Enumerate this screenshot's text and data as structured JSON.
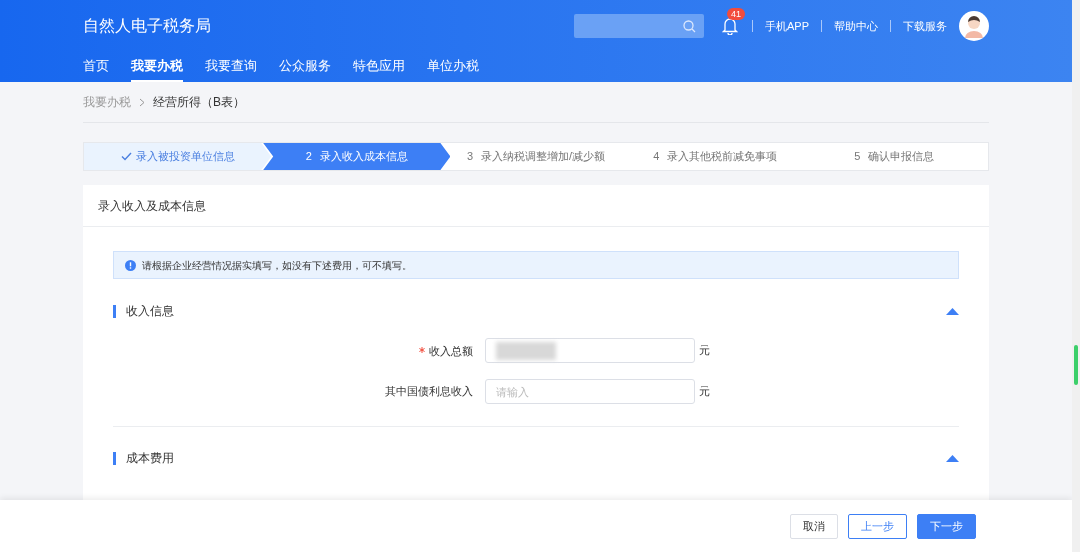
{
  "header": {
    "title": "自然人电子税务局",
    "notification_count": "41",
    "links": [
      "手机APP",
      "帮助中心",
      "下载服务"
    ]
  },
  "nav": [
    {
      "label": "首页",
      "selected": false
    },
    {
      "label": "我要办税",
      "selected": true
    },
    {
      "label": "我要查询",
      "selected": false
    },
    {
      "label": "公众服务",
      "selected": false
    },
    {
      "label": "特色应用",
      "selected": false
    },
    {
      "label": "单位办税",
      "selected": false
    }
  ],
  "breadcrumb": [
    "我要办税",
    "经营所得（B表）"
  ],
  "steps": [
    {
      "label": "录入被投资单位信息",
      "done": true,
      "selected": false
    },
    {
      "number": "2",
      "label": "录入收入成本信息",
      "done": false,
      "selected": true
    },
    {
      "number": "3",
      "label": "录入纳税调整增加/减少额",
      "done": false,
      "selected": false
    },
    {
      "number": "4",
      "label": "录入其他税前减免事项",
      "done": false,
      "selected": false
    },
    {
      "number": "5",
      "label": "确认申报信息",
      "done": false,
      "selected": false
    }
  ],
  "card": {
    "title": "录入收入及成本信息",
    "notice": "请根据企业经营情况据实填写，如没有下述费用，可不填写。",
    "sections": [
      {
        "title": "收入信息",
        "expanded": true,
        "fields": [
          {
            "label": "收入总额",
            "required": true,
            "redacted": true,
            "unit": "元"
          },
          {
            "label": "其中国债利息收入",
            "required": false,
            "redacted": false,
            "placeholder": "请输入",
            "unit": "元"
          }
        ]
      },
      {
        "title": "成本费用",
        "expanded": true
      }
    ]
  },
  "footer": {
    "buttons": [
      {
        "label": "取消",
        "kind": "default"
      },
      {
        "label": "上一步",
        "kind": "outline"
      },
      {
        "label": "下一步",
        "kind": "primary"
      }
    ]
  }
}
